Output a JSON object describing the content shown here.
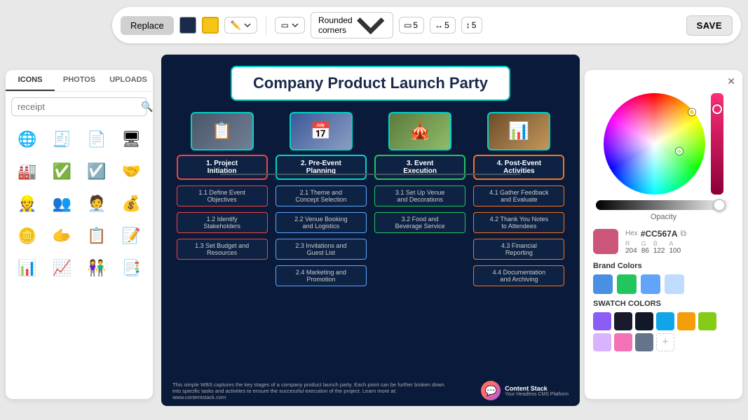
{
  "toolbar": {
    "replace_label": "Replace",
    "save_label": "SAVE",
    "rounded_corners_label": "Rounded corners",
    "shape_num1": "5",
    "shape_num2": "5",
    "shape_num3": "5"
  },
  "left_panel": {
    "tabs": [
      "ICONS",
      "PHOTOS",
      "UPLOADS"
    ],
    "active_tab": "ICONS",
    "search_placeholder": "receipt",
    "icons": [
      {
        "name": "globe-icon",
        "symbol": "🌐"
      },
      {
        "name": "receipt-icon",
        "symbol": "🧾"
      },
      {
        "name": "document-icon",
        "symbol": "📄"
      },
      {
        "name": "server-icon",
        "symbol": "🖥"
      },
      {
        "name": "factory-icon",
        "symbol": "🏭"
      },
      {
        "name": "check-circle-icon",
        "symbol": "✅"
      },
      {
        "name": "check-outline-icon",
        "symbol": "☑"
      },
      {
        "name": "handshake-icon",
        "symbol": "🤝"
      },
      {
        "name": "worker-icon",
        "symbol": "👷"
      },
      {
        "name": "team-icon",
        "symbol": "👥"
      },
      {
        "name": "person-arrow-icon",
        "symbol": "🧑‍💼"
      },
      {
        "name": "money-icon",
        "symbol": "💰"
      },
      {
        "name": "hand-coin-icon",
        "symbol": "🪙"
      },
      {
        "name": "hand-shake2-icon",
        "symbol": "🫱"
      },
      {
        "name": "document2-icon",
        "symbol": "📋"
      },
      {
        "name": "notes-icon",
        "symbol": "📝"
      },
      {
        "name": "grid-doc-icon",
        "symbol": "📊"
      },
      {
        "name": "report-icon",
        "symbol": "📈"
      },
      {
        "name": "team2-icon",
        "symbol": "👫"
      },
      {
        "name": "checklist-icon",
        "symbol": "📑"
      }
    ]
  },
  "canvas": {
    "background_color": "#0a1a3a",
    "title": "Company Product Launch Party",
    "columns": [
      {
        "id": "col1",
        "photo_emoji": "📋",
        "node_label": "1. Project\nInitiation",
        "node_border": "red",
        "children": [
          {
            "label": "1.1 Define Event\nObjectives",
            "border": "red"
          },
          {
            "label": "1.2 Identify\nStakeholders",
            "border": "red"
          },
          {
            "label": "1.3 Set Budget and\nResources",
            "border": "red"
          }
        ]
      },
      {
        "id": "col2",
        "photo_emoji": "📅",
        "node_label": "2. Pre-Event\nPlanning",
        "node_border": "blue",
        "children": [
          {
            "label": "2.1 Theme and\nConcept Selection",
            "border": "blue"
          },
          {
            "label": "2.2 Venue Booking\nand Logistics",
            "border": "blue"
          },
          {
            "label": "2.3 Invitations and\nGuest List",
            "border": "blue"
          },
          {
            "label": "2.4 Marketing and\nPromotion",
            "border": "blue"
          }
        ]
      },
      {
        "id": "col3",
        "photo_emoji": "🎪",
        "node_label": "3. Event\nExecution",
        "node_border": "green",
        "children": [
          {
            "label": "3.1 Set Up Venue\nand Decorations",
            "border": "green"
          },
          {
            "label": "3.2 Food and\nBeverage Service",
            "border": "green"
          }
        ]
      },
      {
        "id": "col4",
        "photo_emoji": "📊",
        "node_label": "4. Post-Event\nActivities",
        "node_border": "orange",
        "children": [
          {
            "label": "4.1 Gather Feedback\nand Evaluate",
            "border": "orange"
          },
          {
            "label": "4.2 Thank You Notes\nto Attendees",
            "border": "orange"
          },
          {
            "label": "4.3 Financial\nReporting",
            "border": "orange"
          },
          {
            "label": "4.4 Documentation\nand Archiving",
            "border": "orange"
          }
        ]
      }
    ],
    "footer_text": "This simple WBS captures the key stages of a company product launch party. Each point can be further broken down into specific tasks and activities to ensure the successful execution of the project. Learn more at: www.contentstack.com",
    "logo_name": "Content Stack",
    "logo_sub": "Your Headless CMS Platform"
  },
  "right_panel": {
    "opacity_label": "Opacity",
    "hex_label": "Hex",
    "hex_value": "#CC567A",
    "r": "204",
    "g": "86",
    "b": "122",
    "a": "100",
    "brand_colors_label": "Brand Colors",
    "brand_colors": [
      "#4a90e2",
      "#22c55e",
      "#60a5fa",
      "#bfdbfe"
    ],
    "swatch_colors_label": "SWATCH COLORS",
    "swatch_colors": [
      "#8b5cf6",
      "#1a1a2e",
      "#111827",
      "#0ea5e9",
      "#f59e0b",
      "#84cc16",
      "#d8b4fe",
      "#f472b6",
      "#64748b"
    ]
  }
}
